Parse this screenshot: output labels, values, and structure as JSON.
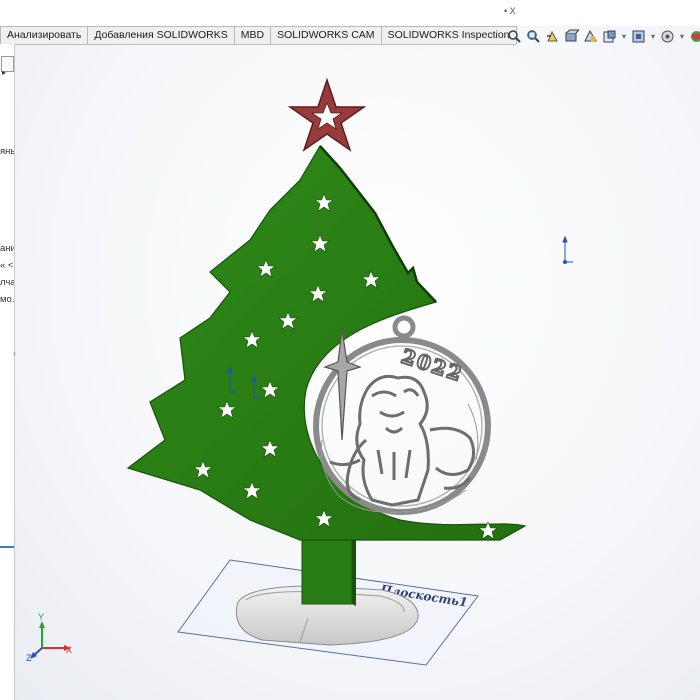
{
  "top_bar": {
    "text": "• X"
  },
  "toolbar": {
    "tabs": [
      {
        "label": "Анализировать"
      },
      {
        "label": "Добавления SOLIDWORKS"
      },
      {
        "label": "MBD"
      },
      {
        "label": "SOLIDWORKS CAM"
      },
      {
        "label": "SOLIDWORKS Inspection"
      }
    ]
  },
  "heads_up_toolbar": {
    "icons": [
      "zoom-to-fit-icon",
      "zoom-area-icon",
      "previous-view-icon",
      "section-view-icon",
      "view-orientation-icon",
      "display-style-icon",
      "hide-show-items-icon",
      "edit-appearance-icon",
      "apply-scene-icon"
    ],
    "dropdown_glyph": "▾"
  },
  "left_panel": {
    "lines": [
      "янь",
      "ани",
      "« <",
      "лча",
      "мо."
    ],
    "collapse_glyph": "‹",
    "expand_glyph": "▸",
    "bottom_glyph": ">"
  },
  "viewport": {
    "plane_label": "Плоскость1",
    "ornament_year": "2022",
    "triad": {
      "x": "X",
      "y": "Y",
      "z": "Z"
    }
  },
  "colors": {
    "tree": "#2a7d15",
    "tree_dark": "#17530a",
    "star": "#9a3b3b",
    "ornament": "#9a9a9a",
    "base": "#dcdcdc",
    "plane_border": "#5a6ea0"
  }
}
